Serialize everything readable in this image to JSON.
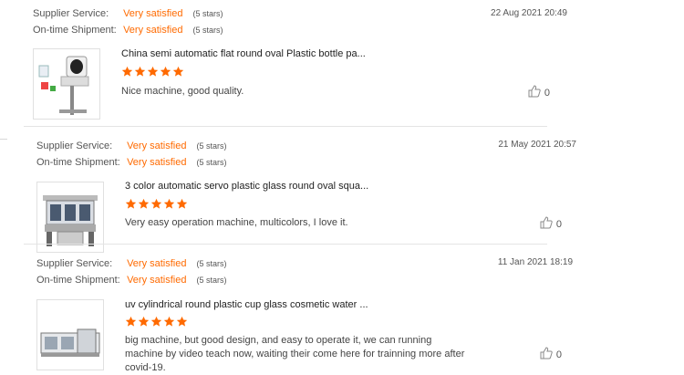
{
  "labels": {
    "supplier_service": "Supplier Service:",
    "ontime_shipment": "On-time Shipment:"
  },
  "colors": {
    "accent": "#ff6a00",
    "divider": "#e4e4e4"
  },
  "reviews": [
    {
      "supplier_rating": "Very satisfied",
      "supplier_stars": "(5 stars)",
      "shipment_rating": "Very satisfied",
      "shipment_stars": "(5 stars)",
      "date": "22 Aug 2021 20:49",
      "product_title": "China semi automatic flat round oval Plastic bottle pa...",
      "star_count": 5,
      "comment": "Nice machine, good quality.",
      "like_icon": "thumbs-up-icon",
      "likes": "0"
    },
    {
      "supplier_rating": "Very satisfied",
      "supplier_stars": "(5 stars)",
      "shipment_rating": "Very satisfied",
      "shipment_stars": "(5 stars)",
      "date": "21 May 2021 20:57",
      "product_title": "3 color automatic servo plastic glass round oval squa...",
      "star_count": 5,
      "comment": "Very easy operation machine, multicolors, I love it.",
      "like_icon": "thumbs-up-icon",
      "likes": "0"
    },
    {
      "supplier_rating": "Very satisfied",
      "supplier_stars": "(5 stars)",
      "shipment_rating": "Very satisfied",
      "shipment_stars": "(5 stars)",
      "date": "11 Jan 2021 18:19",
      "product_title": "uv cylindrical round plastic cup glass cosmetic water ...",
      "star_count": 5,
      "comment": "big machine, but good design, and easy to operate it, we can running machine by video teach now, waiting their come here for trainning more after covid-19.",
      "like_icon": "thumbs-up-icon",
      "likes": "0"
    }
  ]
}
